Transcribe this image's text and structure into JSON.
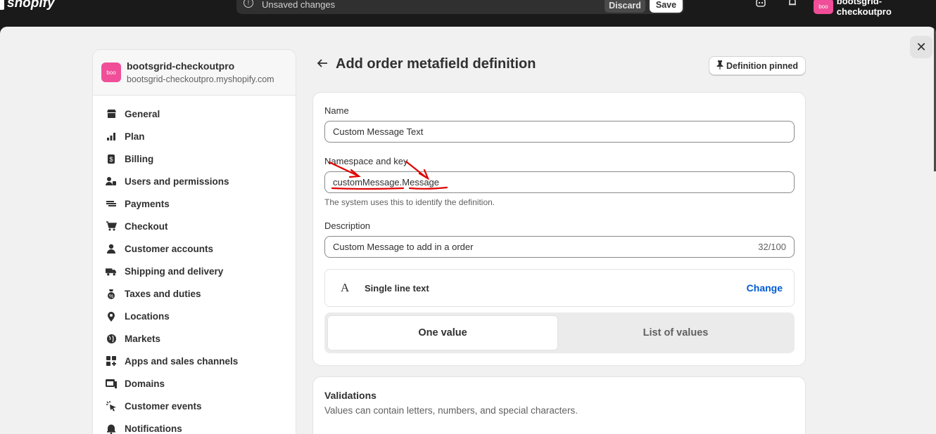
{
  "topbar": {
    "logo": "shopify",
    "unsaved": "Unsaved changes",
    "discard": "Discard",
    "save": "Save",
    "store_avatar": "boo",
    "store_name": "bootsgrid-checkoutpro",
    "icons": [
      "warning-icon",
      "bot-icon",
      "bell-icon"
    ]
  },
  "sidebar": {
    "store_avatar": "boo",
    "store_name": "bootsgrid-checkoutpro",
    "store_domain": "bootsgrid-checkoutpro.myshopify.com",
    "items": [
      {
        "label": "General",
        "icon": "store-icon"
      },
      {
        "label": "Plan",
        "icon": "plan-icon"
      },
      {
        "label": "Billing",
        "icon": "billing-icon"
      },
      {
        "label": "Users and permissions",
        "icon": "users-icon"
      },
      {
        "label": "Payments",
        "icon": "payments-icon"
      },
      {
        "label": "Checkout",
        "icon": "cart-icon"
      },
      {
        "label": "Customer accounts",
        "icon": "person-icon"
      },
      {
        "label": "Shipping and delivery",
        "icon": "truck-icon"
      },
      {
        "label": "Taxes and duties",
        "icon": "tax-icon"
      },
      {
        "label": "Locations",
        "icon": "location-icon"
      },
      {
        "label": "Markets",
        "icon": "globe-icon"
      },
      {
        "label": "Apps and sales channels",
        "icon": "apps-icon"
      },
      {
        "label": "Domains",
        "icon": "domains-icon"
      },
      {
        "label": "Customer events",
        "icon": "events-icon"
      },
      {
        "label": "Notifications",
        "icon": "bell-icon"
      }
    ]
  },
  "page": {
    "title": "Add order metafield definition",
    "pin_label": "Definition pinned"
  },
  "form": {
    "name_label": "Name",
    "name_value": "Custom Message Text",
    "ns_label": "Namespace and key",
    "ns_value": "customMessage.Message",
    "ns_help": "The system uses this to identify the definition.",
    "desc_label": "Description",
    "desc_value": "Custom Message to add in a order",
    "desc_count": "32/100",
    "type_icon": "A",
    "type_label": "Single line text",
    "change_label": "Change",
    "one_value": "One value",
    "list_values": "List of values"
  },
  "validations": {
    "title": "Validations",
    "subtitle": "Values can contain letters, numbers, and special characters."
  },
  "colors": {
    "accent": "#005bd3",
    "avatar": "#f04e98",
    "annotation": "#e00000"
  }
}
